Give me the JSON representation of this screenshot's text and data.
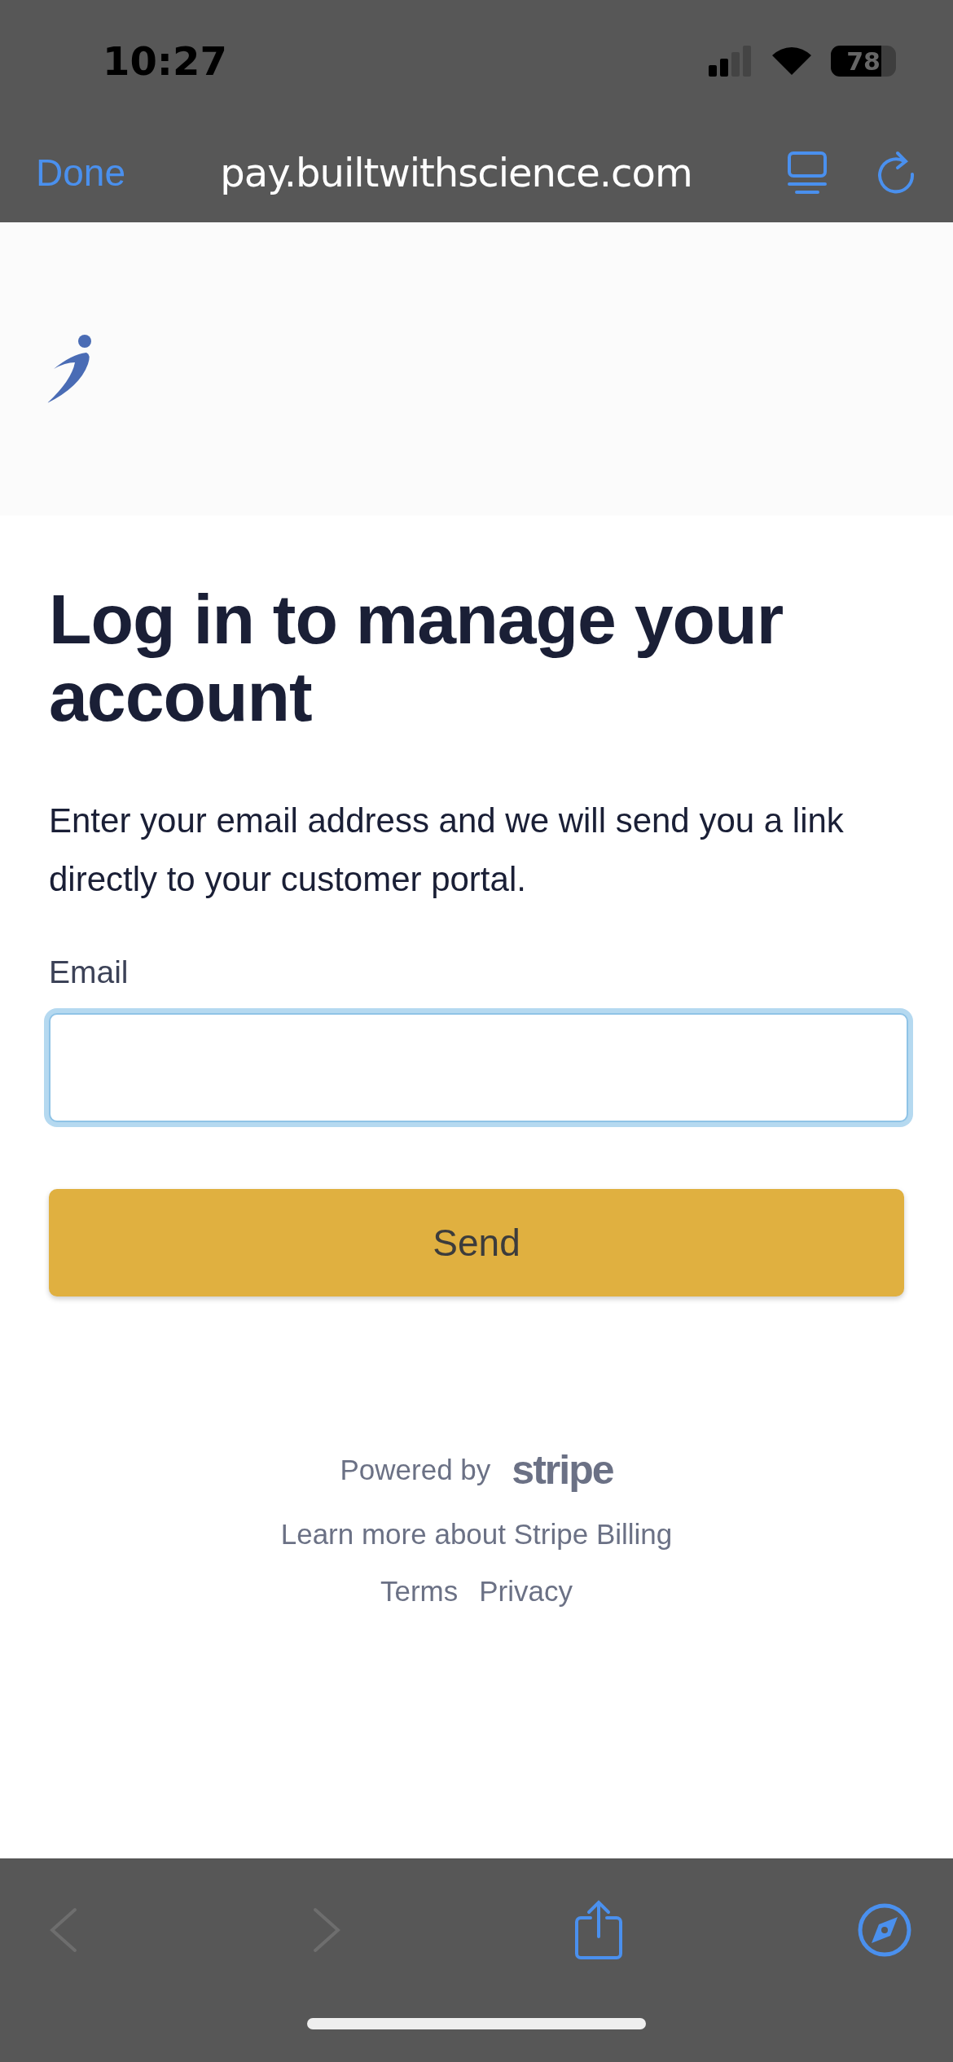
{
  "status_bar": {
    "time": "10:27",
    "battery": "78"
  },
  "browser_toolbar": {
    "done": "Done",
    "url": "pay.builtwithscience.com"
  },
  "page": {
    "title": "Log in to manage your account",
    "description": "Enter your email address and we will send you a link directly to your customer portal.",
    "email_label": "Email",
    "email_focused": true,
    "send_button": "Send"
  },
  "footer": {
    "powered_by": "Powered by",
    "brand": "stripe",
    "learn_more": "Learn more about Stripe Billing",
    "links": [
      "Terms",
      "Privacy"
    ]
  },
  "bottom_toolbar": [
    {
      "kind": "back",
      "disabled": true
    },
    {
      "kind": "forward",
      "disabled": true
    },
    {
      "kind": "share",
      "disabled": false
    },
    {
      "kind": "compass",
      "disabled": false
    }
  ]
}
